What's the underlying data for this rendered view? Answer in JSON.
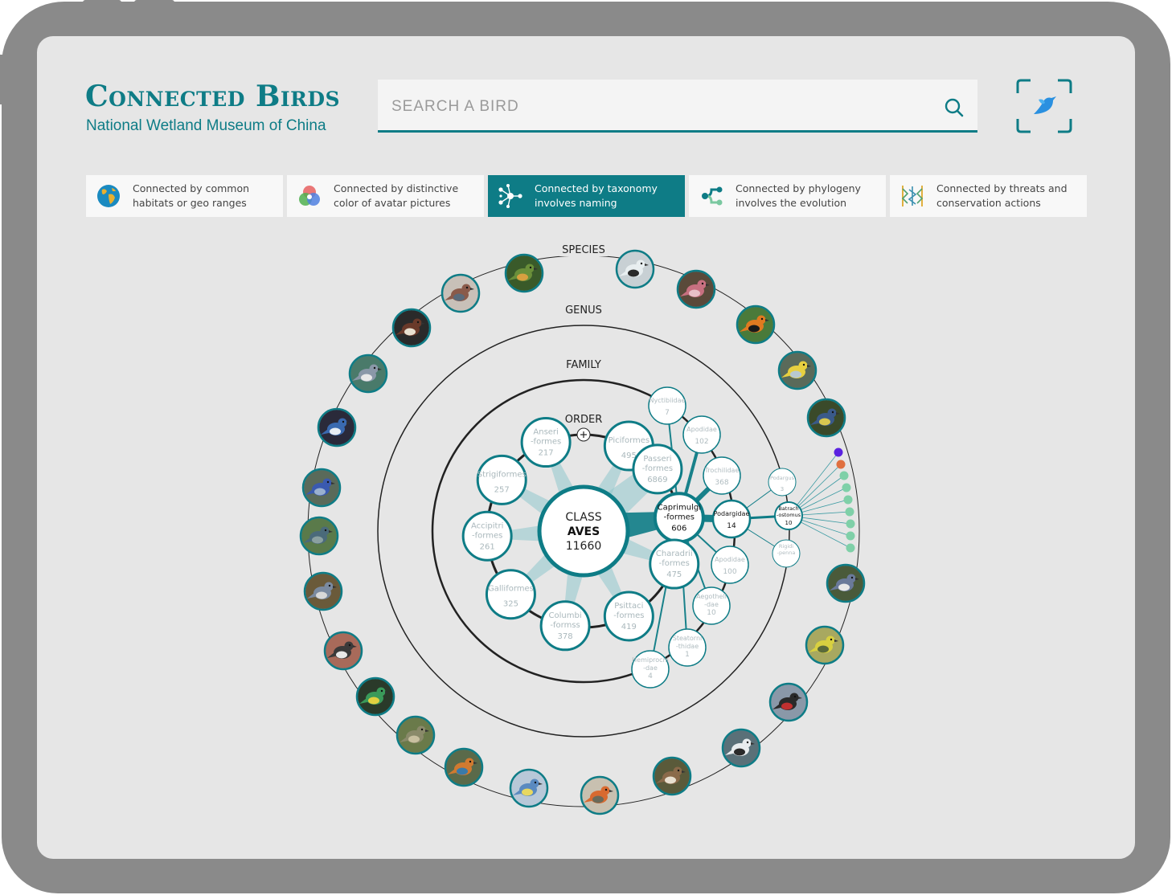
{
  "app": {
    "title": "Connected Birds",
    "subtitle": "National Wetland Museum of China"
  },
  "search": {
    "placeholder": "SEARCH A BIRD",
    "value": ""
  },
  "tabs": [
    {
      "label": "Connected by common habitats or geo ranges",
      "icon": "globe-icon",
      "active": false
    },
    {
      "label": "Connected by distinctive color of avatar pictures",
      "icon": "color-wheel-icon",
      "active": false
    },
    {
      "label": "Connected by taxonomy involves naming",
      "icon": "network-icon",
      "active": true
    },
    {
      "label": "Connected by phylogeny involves the evolution",
      "icon": "phylogeny-icon",
      "active": false
    },
    {
      "label": "Connected by threats and conservation actions",
      "icon": "threats-icon",
      "active": false
    }
  ],
  "rings": {
    "species": "SPECIES",
    "genus": "GENUS",
    "family": "FAMILY",
    "order": "ORDER"
  },
  "center": {
    "label": "CLASS",
    "name": "AVES",
    "count": "11660"
  },
  "orders": [
    {
      "name": "Piciformes",
      "count": "495",
      "highlighted": false
    },
    {
      "name": "Passeri\n-formes",
      "count": "6869",
      "highlighted": false
    },
    {
      "name": "Caprimulgi\n-formes",
      "count": "606",
      "highlighted": true
    },
    {
      "name": "Charadrii\n-formes",
      "count": "475",
      "highlighted": false
    },
    {
      "name": "Psittaci\n-formes",
      "count": "419",
      "highlighted": false
    },
    {
      "name": "Columbi\n-formss",
      "count": "378",
      "highlighted": false
    },
    {
      "name": "Galliformes",
      "count": "325",
      "highlighted": false
    },
    {
      "name": "Accipitri\n-formes",
      "count": "261",
      "highlighted": false
    },
    {
      "name": "Strigiformes",
      "count": "257",
      "highlighted": false
    },
    {
      "name": "Anseri\n-formes",
      "count": "217",
      "highlighted": false
    }
  ],
  "families": [
    {
      "name": "Nyctibiidae",
      "count": "7",
      "highlighted": false
    },
    {
      "name": "Apodidae",
      "count": "102",
      "highlighted": false
    },
    {
      "name": "Trochilidae",
      "count": "368",
      "highlighted": false
    },
    {
      "name": "Podargidae",
      "count": "14",
      "highlighted": true
    },
    {
      "name": "Apodidae",
      "count": "100",
      "highlighted": false
    },
    {
      "name": "Aegotheli\n-dae",
      "count": "10",
      "highlighted": false
    },
    {
      "name": "Steatorni\n-thidae",
      "count": "1",
      "highlighted": false
    },
    {
      "name": "Hemiprocni\n-dae",
      "count": "4",
      "highlighted": false
    }
  ],
  "genera": [
    {
      "name": "Podargus",
      "count": "3",
      "highlighted": false
    },
    {
      "name": "Batrach\n-ostomus",
      "count": "10",
      "highlighted": true
    },
    {
      "name": "Rigidi\n-penna",
      "count": "",
      "highlighted": false
    }
  ],
  "species_dot_colors": [
    "#5a22e0",
    "#e07040",
    "#7fd0a8",
    "#7fd0a8",
    "#7fd0a8",
    "#7fd0a8",
    "#7fd0a8",
    "#7fd0a8",
    "#7fd0a8",
    "#7fd0a8"
  ],
  "bird_avatars": [
    {
      "name": "lovebird-avatar",
      "colors": [
        "#6a8f3a",
        "#d8a040",
        "#3a5a2a"
      ]
    },
    {
      "name": "kingfisher-white-avatar",
      "colors": [
        "#e8eef0",
        "#2a2a2a",
        "#c8d0d4"
      ]
    },
    {
      "name": "rosefinch-avatar",
      "colors": [
        "#c87080",
        "#e8c0c8",
        "#5a4a3a"
      ]
    },
    {
      "name": "oriole-avatar",
      "colors": [
        "#e07a20",
        "#1a1a1a",
        "#4a7a3a"
      ]
    },
    {
      "name": "warbler-yellow-avatar",
      "colors": [
        "#e8d040",
        "#b8c8d0",
        "#5a6a5a"
      ]
    },
    {
      "name": "blue-tit-avatar",
      "colors": [
        "#3a5a8a",
        "#d8c850",
        "#3a4a2a"
      ]
    },
    {
      "name": "nuthatch-avatar",
      "colors": [
        "#6a7a9a",
        "#e8e8e8",
        "#4a5a3a"
      ]
    },
    {
      "name": "yellow-warbler-avatar",
      "colors": [
        "#d8d040",
        "#5a6a3a",
        "#a8a860"
      ]
    },
    {
      "name": "flycatcher-avatar",
      "colors": [
        "#2a2a2a",
        "#c03030",
        "#8a98a8"
      ]
    },
    {
      "name": "tern-avatar",
      "colors": [
        "#e8ecee",
        "#2a2a2a",
        "#5a7078"
      ]
    },
    {
      "name": "sparrow-avatar",
      "colors": [
        "#8a6a4a",
        "#e8e0d0",
        "#5a5a3a"
      ]
    },
    {
      "name": "robin-avatar",
      "colors": [
        "#d86a30",
        "#6a6a5a",
        "#c8c0b0"
      ]
    },
    {
      "name": "bluetit-small-avatar",
      "colors": [
        "#5a8ac0",
        "#e8d860",
        "#b8c8d8"
      ]
    },
    {
      "name": "kingfisher-orange-avatar",
      "colors": [
        "#d07a30",
        "#3a7aa8",
        "#5a6a4a"
      ]
    },
    {
      "name": "thrush-avatar",
      "colors": [
        "#8a8a6a",
        "#c8c0a0",
        "#6a7a4a"
      ]
    },
    {
      "name": "green-jay-avatar",
      "colors": [
        "#3a9a5a",
        "#e0d040",
        "#2a3a2a"
      ]
    },
    {
      "name": "woodpecker-avatar",
      "colors": [
        "#3a3a3a",
        "#e8e8e8",
        "#a86a5a"
      ]
    },
    {
      "name": "heron-avatar",
      "colors": [
        "#7a8aa0",
        "#d8d8d8",
        "#6a5a3a"
      ]
    },
    {
      "name": "night-heron-avatar",
      "colors": [
        "#4a6a7a",
        "#8aa0a0",
        "#5a7a4a"
      ]
    },
    {
      "name": "fairy-wren-avatar",
      "colors": [
        "#3a5ab0",
        "#9ab0d0",
        "#5a6a5a"
      ]
    },
    {
      "name": "blue-jay-avatar",
      "colors": [
        "#3a6ab0",
        "#e8eef4",
        "#2a2a3a"
      ]
    },
    {
      "name": "gnatcatcher-avatar",
      "colors": [
        "#8a98a8",
        "#e8e8e8",
        "#4a7a6a"
      ]
    },
    {
      "name": "goose-avatar",
      "colors": [
        "#6a3a2a",
        "#e8e0d0",
        "#2a2a2a"
      ]
    },
    {
      "name": "pigeon-avatar",
      "colors": [
        "#8a5a4a",
        "#5a6a7a",
        "#c8c0b8"
      ]
    }
  ]
}
